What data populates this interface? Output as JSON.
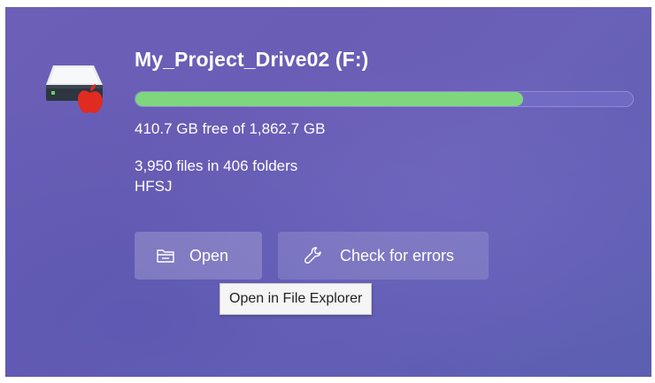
{
  "drive": {
    "title": "My_Project_Drive02 (F:)",
    "usage_fraction": 0.78,
    "free_text": "410.7 GB free of 1,862.7 GB",
    "files_text": "3,950 files in 406 folders",
    "filesystem": "HFSJ",
    "icon": "hard-drive-icon",
    "badge_icon": "apple-logo-icon",
    "colors": {
      "bar_fill": "#7ed77f",
      "background": "#6a5db5"
    }
  },
  "actions": {
    "open_label": "Open",
    "open_icon": "folder-icon",
    "check_label": "Check for errors",
    "check_icon": "wrench-icon"
  },
  "tooltip": {
    "text": "Open in File Explorer"
  }
}
